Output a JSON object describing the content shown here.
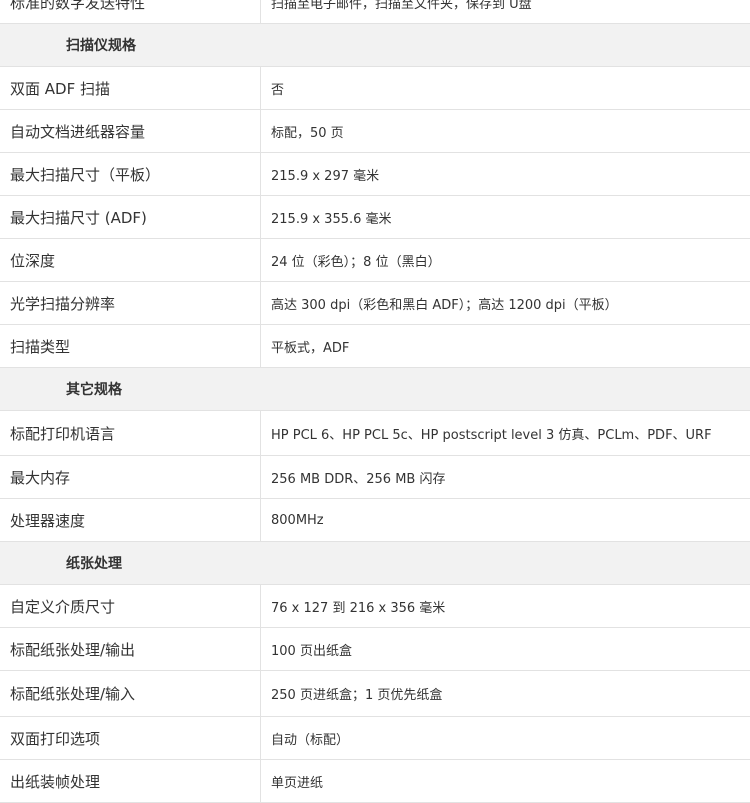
{
  "rows": [
    {
      "type": "row",
      "label": "标准的数字发送特性",
      "value": "扫描至电子邮件，扫描至文件夹，保存到 U盘",
      "h": 43
    },
    {
      "type": "section",
      "label": "扫描仪规格",
      "h": 43
    },
    {
      "type": "row",
      "label": "双面 ADF 扫描",
      "value": "否",
      "h": 43
    },
    {
      "type": "row",
      "label": "自动文档进纸器容量",
      "value": "标配，50 页",
      "h": 43
    },
    {
      "type": "row",
      "label": "最大扫描尺寸（平板）",
      "value": "215.9 x 297 毫米",
      "h": 43
    },
    {
      "type": "row",
      "label": "最大扫描尺寸 (ADF)",
      "value": "215.9 x 355.6 毫米",
      "h": 43
    },
    {
      "type": "row",
      "label": "位深度",
      "value": "24 位（彩色）；8 位（黑白）",
      "h": 43
    },
    {
      "type": "row",
      "label": "光学扫描分辨率",
      "value": "高达 300 dpi（彩色和黑白 ADF）；高达 1200 dpi（平板）",
      "h": 43
    },
    {
      "type": "row",
      "label": "扫描类型",
      "value": "平板式，ADF",
      "h": 43
    },
    {
      "type": "section",
      "label": "其它规格",
      "h": 43
    },
    {
      "type": "row",
      "label": "标配打印机语言",
      "value": "HP PCL 6、HP PCL 5c、HP postscript level 3 仿真、PCLm、PDF、URF",
      "h": 45
    },
    {
      "type": "row",
      "label": "最大内存",
      "value": "256 MB DDR、256 MB 闪存",
      "h": 43
    },
    {
      "type": "row",
      "label": "处理器速度",
      "value": "800MHz",
      "h": 43
    },
    {
      "type": "section",
      "label": "纸张处理",
      "h": 43
    },
    {
      "type": "row",
      "label": "自定义介质尺寸",
      "value": "76 x 127 到 216 x 356 毫米",
      "h": 43
    },
    {
      "type": "row",
      "label": "标配纸张处理/输出",
      "value": "100 页出纸盒",
      "h": 43
    },
    {
      "type": "row",
      "label": "标配纸张处理/输入",
      "value": "250 页进纸盒；1 页优先纸盒",
      "h": 46
    },
    {
      "type": "row",
      "label": "双面打印选项",
      "value": "自动（标配）",
      "h": 43
    },
    {
      "type": "row",
      "label": "出纸装帧处理",
      "value": "单页进纸",
      "h": 43
    }
  ]
}
